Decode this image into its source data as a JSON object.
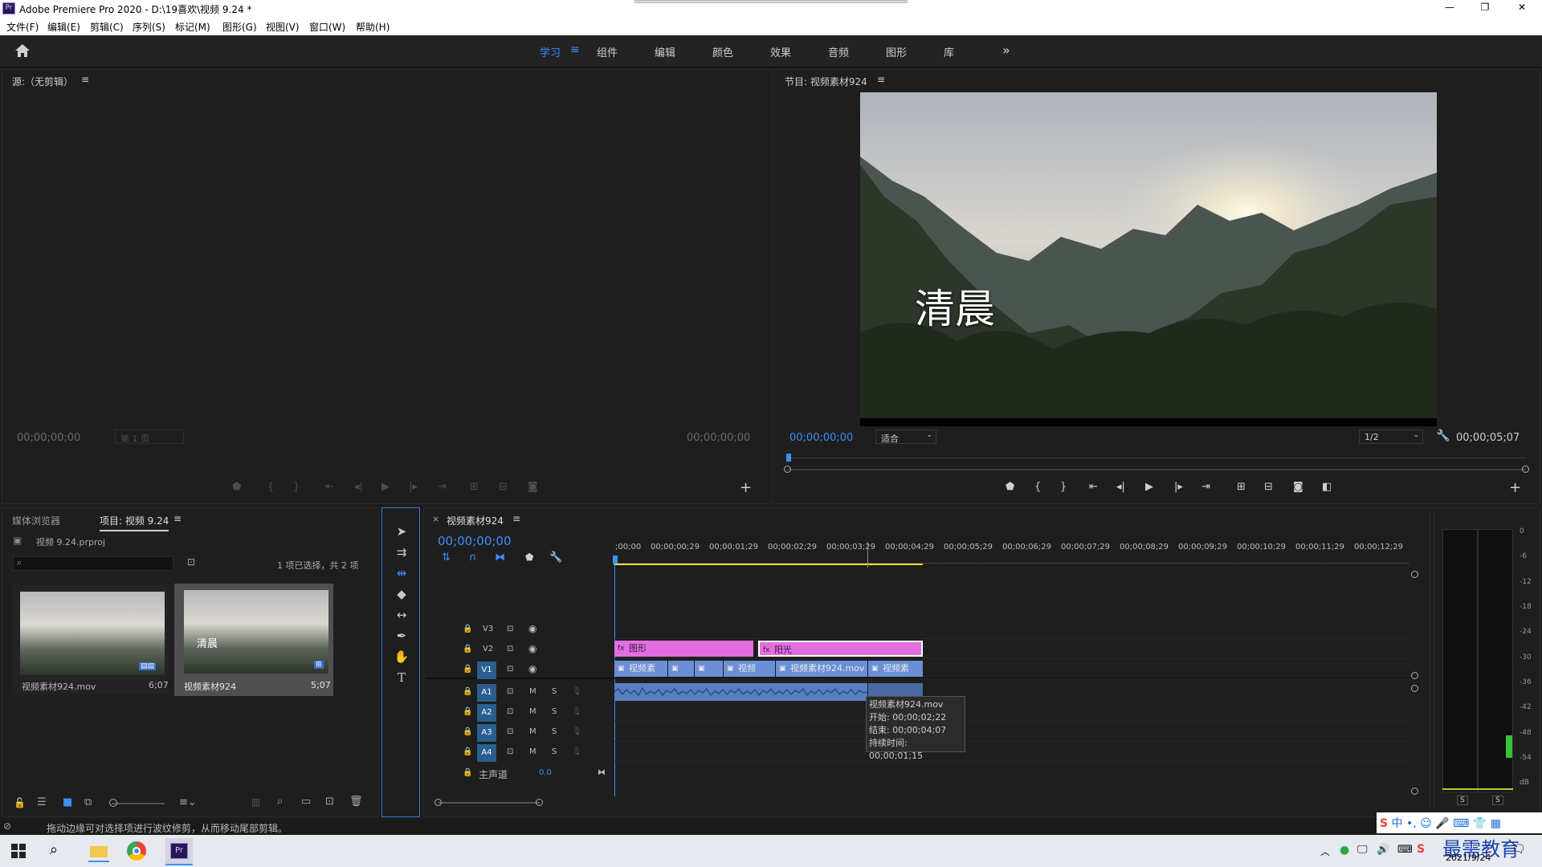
{
  "window": {
    "title": "Adobe Premiere Pro 2020 - D:\\19喜欢\\视频 9.24 *",
    "controls": [
      "—",
      "❐",
      "✕"
    ]
  },
  "menu": [
    "文件(F)",
    "编辑(E)",
    "剪辑(C)",
    "序列(S)",
    "标记(M)",
    "图形(G)",
    "视图(V)",
    "窗口(W)",
    "帮助(H)"
  ],
  "workspaces": {
    "active": "学习",
    "items": [
      "组件",
      "编辑",
      "颜色",
      "效果",
      "音频",
      "图形",
      "库"
    ],
    "more": "»"
  },
  "source": {
    "title": "源:（无剪辑）",
    "tc_left": "00;00;00;00",
    "page_select": "第 1 页",
    "tc_right": "00;00;00;00"
  },
  "program": {
    "title": "节目: 视频素材924",
    "overlay_text": "清晨",
    "tc_current": "00;00;00;00",
    "fit": "适合",
    "quality": "1/2",
    "tc_duration": "00;00;05;07"
  },
  "project": {
    "tabs": [
      "媒体浏览器",
      "项目: 视频 9.24"
    ],
    "file": "视频 9.24.prproj",
    "selection_info": "1 项已选择，共 2 项",
    "items": [
      {
        "name": "视频素材924.mov",
        "duration": "6;07"
      },
      {
        "name": "视频素材924",
        "duration": "5;07",
        "thumb_text": "清晨"
      }
    ]
  },
  "timeline": {
    "tab": "视频素材924",
    "timecode": "00;00;00;00",
    "ruler": [
      ";00;00",
      "00;00;00;29",
      "00;00;01;29",
      "00;00;02;29",
      "00;00;03;29",
      "00;00;04;29",
      "00;00;05;29",
      "00;00;06;29",
      "00;00;07;29",
      "00;00;08;29",
      "00;00;09;29",
      "00;00;10;29",
      "00;00;11;29",
      "00;00;12;29"
    ],
    "video_tracks": [
      "V3",
      "V2",
      "V1"
    ],
    "audio_tracks": [
      "A1",
      "A2",
      "A3",
      "A4"
    ],
    "track_m": "M",
    "track_s": "S",
    "master_label": "主声道",
    "master_value": "0.0",
    "graphics_clips": [
      "图形",
      "阳光"
    ],
    "video_clips": [
      "视频素",
      "视频",
      "视频素材924.mov",
      "视频素"
    ],
    "tooltip": {
      "name": "视频素材924.mov",
      "start": "开始: 00;00;02;22",
      "end": "结束: 00;00;04;07",
      "duration": "持续时间: 00;00;01;15"
    }
  },
  "meter": {
    "scale": [
      "0",
      "-6",
      "-12",
      "-18",
      "-24",
      "-30",
      "-36",
      "-42",
      "-48",
      "-54",
      "dB"
    ],
    "solo": [
      "S",
      "S"
    ]
  },
  "status": {
    "hint": "拖动边缘可对选择项进行波纹修剪，从而移动尾部剪辑。"
  },
  "taskbar": {
    "date": "2021/9/24",
    "ime_text": "中",
    "watermark": "最需教育"
  },
  "colors": {
    "accent": "#3b8fff",
    "graphics_clip": "#e26ee0",
    "video_clip": "#6b8fd6",
    "audio_clip": "#5a7fbf",
    "workarea": "#e6e02a"
  }
}
